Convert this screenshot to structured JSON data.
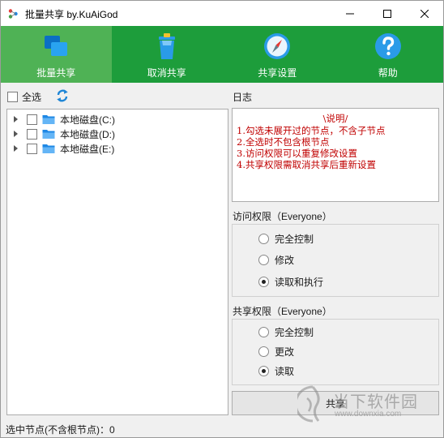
{
  "window": {
    "title": "批量共享 by.KuAiGod"
  },
  "toolbar": {
    "items": [
      {
        "label": "批量共享",
        "icon": "batch-share-icon"
      },
      {
        "label": "取消共享",
        "icon": "trash-icon"
      },
      {
        "label": "共享设置",
        "icon": "compass-icon"
      },
      {
        "label": "帮助",
        "icon": "help-icon"
      }
    ],
    "active_index": 0,
    "colors": {
      "bar": "#1d9d3b",
      "active": "#4fb255"
    }
  },
  "left": {
    "select_all_label": "全选",
    "tree": [
      {
        "label": "本地磁盘(C:)"
      },
      {
        "label": "本地磁盘(D:)"
      },
      {
        "label": "本地磁盘(E:)"
      }
    ]
  },
  "log": {
    "title": "日志",
    "heading": "\\说明/",
    "lines": [
      "1.勾选未展开过的节点，不含子节点",
      "2.全选时不包含根节点",
      "3.访问权限可以重复修改设置",
      "4.共享权限需取消共享后重新设置"
    ],
    "color": "#c00000"
  },
  "access": {
    "title": "访问权限（Everyone）",
    "options": [
      "完全控制",
      "修改",
      "读取和执行"
    ],
    "selected": 2
  },
  "share_perm": {
    "title": "共享权限（Everyone）",
    "options": [
      "完全控制",
      "更改",
      "读取"
    ],
    "selected": 2
  },
  "share_button": {
    "label": "共享"
  },
  "status": {
    "text": "选中节点(不含根节点)：0"
  },
  "watermark": {
    "name": "当下软件园",
    "url": "www.downxia.com"
  }
}
